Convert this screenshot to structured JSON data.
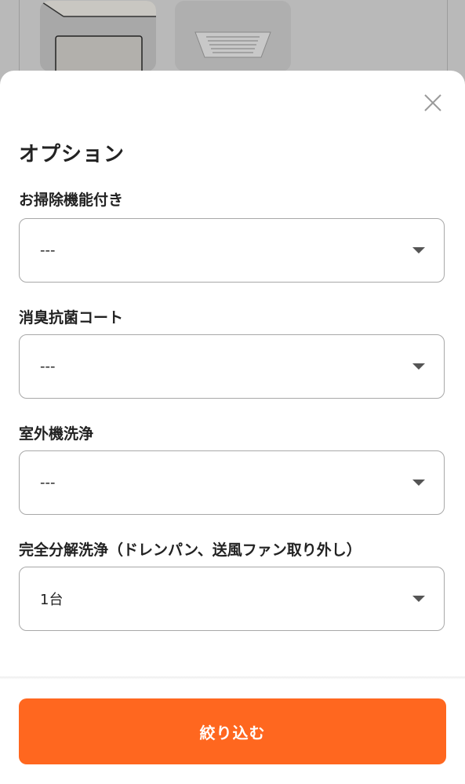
{
  "sheet": {
    "title": "オプション",
    "fields": [
      {
        "label": "お掃除機能付き",
        "value": "---"
      },
      {
        "label": "消臭抗菌コート",
        "value": "---"
      },
      {
        "label": "室外機洗浄",
        "value": "---"
      },
      {
        "label": "完全分解洗浄（ドレンパン、送風ファン取り外し）",
        "value": "1台"
      }
    ],
    "submit_label": "絞り込む"
  },
  "colors": {
    "accent": "#ff671f",
    "overlay": "#b9b9b9"
  },
  "icons": {
    "close": "close-icon",
    "dropdown": "chevron-down-icon"
  }
}
